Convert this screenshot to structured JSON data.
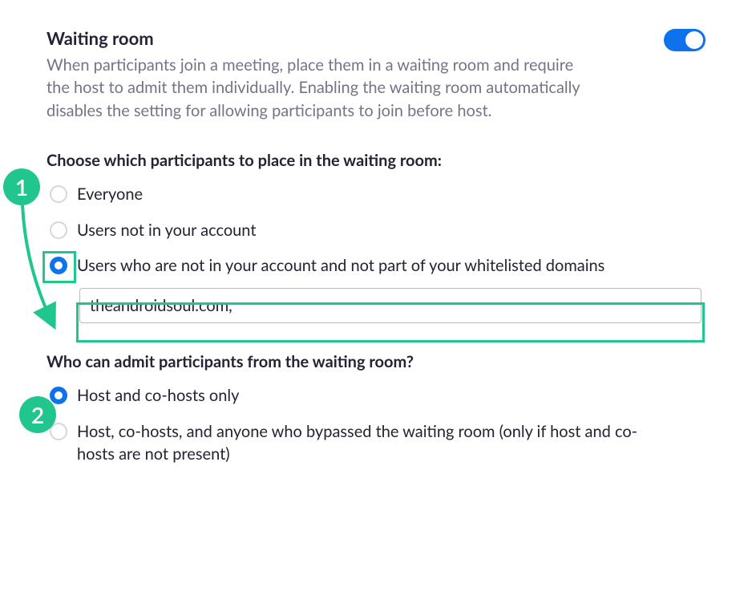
{
  "title": "Waiting room",
  "description": "When participants join a meeting, place them in a waiting room and require the host to admit them individually. Enabling the waiting room automatically disables the setting for allowing participants to join before host.",
  "toggle_on": true,
  "section1": {
    "label": "Choose which participants to place in the waiting room:",
    "options": [
      {
        "label": "Everyone",
        "selected": false
      },
      {
        "label": "Users not in your account",
        "selected": false
      },
      {
        "label": "Users who are not in your account and not part of your whitelisted domains",
        "selected": true
      }
    ],
    "domain_value": "theandroidsoul.com, "
  },
  "section2": {
    "label": "Who can admit participants from the waiting room?",
    "options": [
      {
        "label": "Host and co-hosts only",
        "selected": true
      },
      {
        "label": "Host, co-hosts, and anyone who bypassed the waiting room (only if host and co-hosts are not present)",
        "selected": false
      }
    ]
  },
  "annotations": {
    "badge1": "1",
    "badge2": "2"
  }
}
